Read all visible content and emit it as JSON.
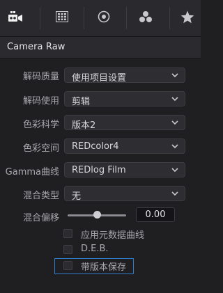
{
  "toolbar": {
    "icons": [
      "camera-raw-icon",
      "color-chart-icon",
      "color-wheel-icon",
      "color-dots-icon",
      "star-icon"
    ]
  },
  "section": {
    "title": "Camera Raw"
  },
  "settings": {
    "decode_quality": {
      "label": "解码质量",
      "value": "使用项目设置"
    },
    "decode_using": {
      "label": "解码使用",
      "value": "剪辑"
    },
    "color_science": {
      "label": "色彩科学",
      "value": "版本2"
    },
    "color_space": {
      "label": "色彩空间",
      "value": "REDcolor4"
    },
    "gamma_curve": {
      "label": "Gamma曲线",
      "value": "REDlog Film"
    },
    "blend_type": {
      "label": "混合类型",
      "value": "无"
    },
    "blend_bias": {
      "label": "混合偏移",
      "value": "0.00",
      "slider_fraction": 0.5
    }
  },
  "checkboxes": {
    "apply_metadata_curve": {
      "label": "应用元数据曲线",
      "checked": false
    },
    "deb": {
      "label": "D.E.B.",
      "checked": false
    },
    "save_with_version": {
      "label": "带版本保存",
      "checked": false,
      "focused": true
    }
  },
  "colors": {
    "focus_ring": "#2f7fd0",
    "toolbar_icon": "#c8c8cc",
    "toolbar_icon_active": "#f2f2f2"
  }
}
